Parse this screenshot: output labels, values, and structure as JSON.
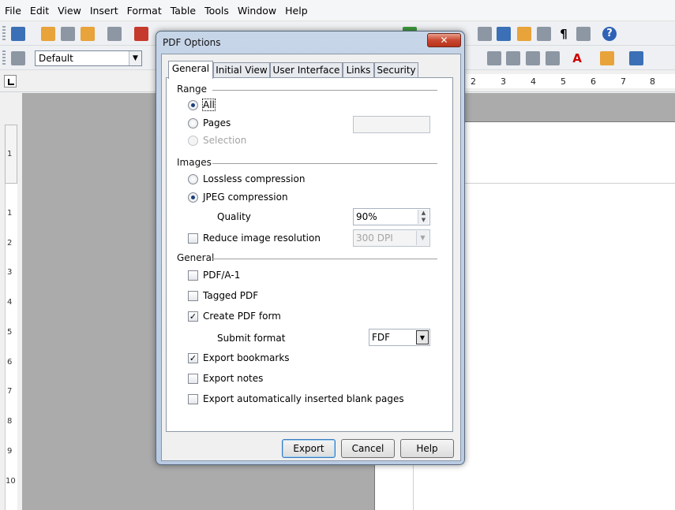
{
  "menubar": {
    "items": [
      "File",
      "Edit",
      "View",
      "Insert",
      "Format",
      "Table",
      "Tools",
      "Window",
      "Help"
    ]
  },
  "formatting": {
    "style_value": "Default"
  },
  "ruler": {
    "top_numbers": [
      "2",
      "3",
      "4",
      "5",
      "6",
      "7",
      "8"
    ],
    "left_numbers": [
      "1",
      "1",
      "2",
      "3",
      "4",
      "5",
      "6",
      "7",
      "8",
      "9",
      "10"
    ]
  },
  "dialog": {
    "title": "PDF Options",
    "close_label": "✕",
    "tabs": [
      "General",
      "Initial View",
      "User Interface",
      "Links",
      "Security"
    ],
    "range": {
      "label": "Range",
      "all": "All",
      "pages": "Pages",
      "selection": "Selection",
      "pages_value": ""
    },
    "images": {
      "label": "Images",
      "lossless": "Lossless compression",
      "jpeg": "JPEG compression",
      "quality_label": "Quality",
      "quality_value": "90%",
      "reduce_label": "Reduce image resolution",
      "resolution_value": "300 DPI"
    },
    "general": {
      "label": "General",
      "pdfa": "PDF/A-1",
      "tagged": "Tagged PDF",
      "create_form": "Create PDF form",
      "submit_format_label": "Submit format",
      "submit_format_value": "FDF",
      "export_bookmarks": "Export bookmarks",
      "export_notes": "Export notes",
      "export_blank": "Export automatically inserted blank pages"
    },
    "buttons": {
      "export": "Export",
      "cancel": "Cancel",
      "help": "Help"
    }
  }
}
